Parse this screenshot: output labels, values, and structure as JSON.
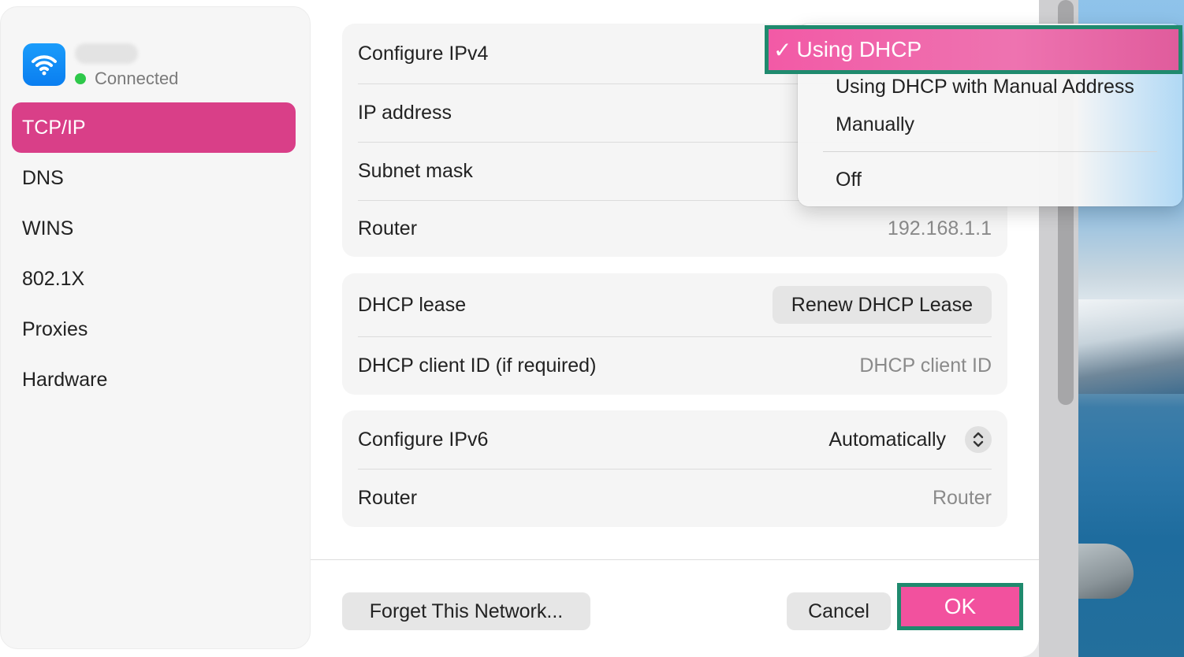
{
  "network": {
    "status": "Connected",
    "icon": "wifi-icon"
  },
  "sidebar": {
    "items": [
      {
        "label": "TCP/IP"
      },
      {
        "label": "DNS"
      },
      {
        "label": "WINS"
      },
      {
        "label": "802.1X"
      },
      {
        "label": "Proxies"
      },
      {
        "label": "Hardware"
      }
    ],
    "active_index": 0
  },
  "ipv4": {
    "configure_label": "Configure IPv4",
    "ip_label": "IP address",
    "subnet_label": "Subnet mask",
    "router_label": "Router",
    "router_value": "192.168.1.1"
  },
  "dhcp": {
    "lease_label": "DHCP lease",
    "renew_button": "Renew DHCP Lease",
    "client_id_label": "DHCP client ID (if required)",
    "client_id_placeholder": "DHCP client ID"
  },
  "ipv6": {
    "configure_label": "Configure IPv6",
    "configure_value": "Automatically",
    "router_label": "Router",
    "router_placeholder": "Router"
  },
  "footer": {
    "forget_button": "Forget This Network...",
    "cancel_button": "Cancel",
    "ok_button": "OK"
  },
  "dropdown": {
    "selected": "Using DHCP",
    "check": "✓",
    "options": [
      "Using DHCP with Manual Address",
      "Manually",
      "Off"
    ]
  },
  "colors": {
    "accent": "#d93f88",
    "highlight_pink": "#f2519e",
    "highlight_border": "#1f8a6e",
    "status_green": "#2ec84a"
  }
}
